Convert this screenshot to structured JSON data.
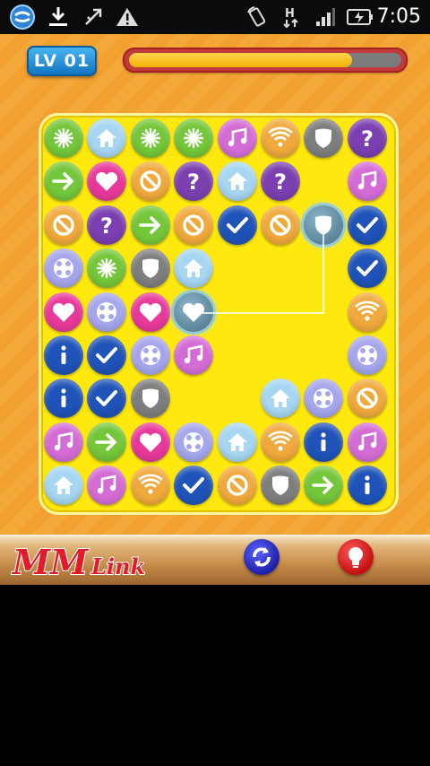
{
  "status_bar": {
    "time": "7:05",
    "icons": [
      "app-icon",
      "download-icon",
      "usb-debug-icon",
      "warning-icon",
      "rotate-icon",
      "h-data-icon",
      "signal-icon",
      "battery-charging-icon"
    ]
  },
  "game": {
    "level_label": "LV 01",
    "progress": 0.82,
    "colors": {
      "green": "#74c63a",
      "blue": "#a6d6f2",
      "purple": "#7b3fb0",
      "pink": "#e8389a",
      "orange": "#f0a93c",
      "violet": "#d46cd6",
      "lavender": "#a5a6ec",
      "darkblue": "#1f53b8",
      "gray": "#7e7e7e",
      "board": "#ffe80d"
    },
    "grid": [
      [
        "sunburst",
        "house",
        "sunburst",
        "sunburst",
        "music",
        "wifi",
        "shield",
        "question"
      ],
      [
        "arrow",
        "heart",
        "ban",
        "question",
        "house",
        "question",
        "",
        "music"
      ],
      [
        "ban",
        "question",
        "arrow",
        "ban",
        "check",
        "ban",
        "shield-sel",
        "check"
      ],
      [
        "dots",
        "sunburst",
        "shield",
        "house",
        "",
        "",
        "",
        "check"
      ],
      [
        "heart",
        "dots",
        "heart",
        "heart-sel",
        "",
        "",
        "",
        "wifi"
      ],
      [
        "info",
        "check",
        "dots",
        "music",
        "",
        "",
        "",
        "dots"
      ],
      [
        "info",
        "check",
        "shield",
        "",
        "",
        "house",
        "dots",
        "ban"
      ],
      [
        "music",
        "arrow",
        "heart",
        "dots",
        "house",
        "wifi",
        "info",
        "music"
      ],
      [
        "house",
        "music",
        "wifi",
        "check",
        "ban",
        "shield",
        "arrow",
        "info"
      ]
    ]
  },
  "footer": {
    "logo_text": "MM",
    "logo_sub": "Link",
    "shuffle": "shuffle-icon",
    "hint": "hint-bulb-icon"
  }
}
